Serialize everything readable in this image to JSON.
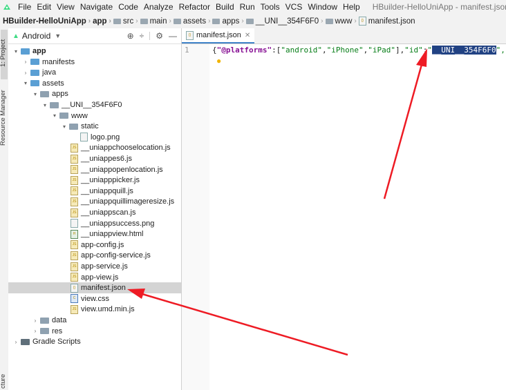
{
  "menubar": {
    "items": [
      "File",
      "Edit",
      "View",
      "Navigate",
      "Code",
      "Analyze",
      "Refactor",
      "Build",
      "Run",
      "Tools",
      "VCS",
      "Window",
      "Help"
    ],
    "title": "HBuilder-HelloUniApp - manifest.json [HBuilder-Hello"
  },
  "breadcrumb": [
    "HBuilder-HelloUniApp",
    "app",
    "src",
    "main",
    "assets",
    "apps",
    "__UNI__354F6F0",
    "www",
    "manifest.json"
  ],
  "side_tabs": {
    "project": "1: Project",
    "resource": "Resource Manager",
    "structure": "cture"
  },
  "project_panel": {
    "view_selector": "Android",
    "tree": [
      {
        "label": "app",
        "depth": 0,
        "arrow": "▾",
        "icon": "folder-blue"
      },
      {
        "label": "manifests",
        "depth": 1,
        "arrow": "›",
        "icon": "folder-blue"
      },
      {
        "label": "java",
        "depth": 1,
        "arrow": "›",
        "icon": "folder-blue"
      },
      {
        "label": "assets",
        "depth": 1,
        "arrow": "▾",
        "icon": "folder-blue"
      },
      {
        "label": "apps",
        "depth": 2,
        "arrow": "▾",
        "icon": "folder"
      },
      {
        "label": "__UNI__354F6F0",
        "depth": 3,
        "arrow": "▾",
        "icon": "folder"
      },
      {
        "label": "www",
        "depth": 4,
        "arrow": "▾",
        "icon": "folder"
      },
      {
        "label": "static",
        "depth": 5,
        "arrow": "▾",
        "icon": "folder"
      },
      {
        "label": "logo.png",
        "depth": 6,
        "arrow": "",
        "icon": "file"
      },
      {
        "label": "__uniappchooselocation.js",
        "depth": 5,
        "arrow": "",
        "icon": "js"
      },
      {
        "label": "__uniappes6.js",
        "depth": 5,
        "arrow": "",
        "icon": "js"
      },
      {
        "label": "__uniappopenlocation.js",
        "depth": 5,
        "arrow": "",
        "icon": "js"
      },
      {
        "label": "__uniapppicker.js",
        "depth": 5,
        "arrow": "",
        "icon": "js"
      },
      {
        "label": "__uniappquill.js",
        "depth": 5,
        "arrow": "",
        "icon": "js"
      },
      {
        "label": "__uniappquillimageresize.js",
        "depth": 5,
        "arrow": "",
        "icon": "js"
      },
      {
        "label": "__uniappscan.js",
        "depth": 5,
        "arrow": "",
        "icon": "js"
      },
      {
        "label": "__uniappsuccess.png",
        "depth": 5,
        "arrow": "",
        "icon": "file"
      },
      {
        "label": "__uniappview.html",
        "depth": 5,
        "arrow": "",
        "icon": "html"
      },
      {
        "label": "app-config.js",
        "depth": 5,
        "arrow": "",
        "icon": "js"
      },
      {
        "label": "app-config-service.js",
        "depth": 5,
        "arrow": "",
        "icon": "js"
      },
      {
        "label": "app-service.js",
        "depth": 5,
        "arrow": "",
        "icon": "js"
      },
      {
        "label": "app-view.js",
        "depth": 5,
        "arrow": "",
        "icon": "js"
      },
      {
        "label": "manifest.json",
        "depth": 5,
        "arrow": "",
        "icon": "json",
        "selected": true
      },
      {
        "label": "view.css",
        "depth": 5,
        "arrow": "",
        "icon": "css"
      },
      {
        "label": "view.umd.min.js",
        "depth": 5,
        "arrow": "",
        "icon": "js"
      },
      {
        "label": "data",
        "depth": 2,
        "arrow": "›",
        "icon": "folder"
      },
      {
        "label": "res",
        "depth": 2,
        "arrow": "›",
        "icon": "folder"
      },
      {
        "label": "Gradle Scripts",
        "depth": 0,
        "arrow": "›",
        "icon": "gradle"
      }
    ]
  },
  "editor": {
    "tab_label": "manifest.json",
    "line_number": "1",
    "code_prefix": "{\"@platforms\":[\"android\",\"iPhone\",\"iPad\"],\"id\":\"",
    "code_highlight": "__UNI__354F6F0",
    "code_suffix": "\",\"nam"
  },
  "colors": {
    "accent": "#4083c9",
    "arrow": "#ee1b24",
    "selection": "#214283"
  }
}
